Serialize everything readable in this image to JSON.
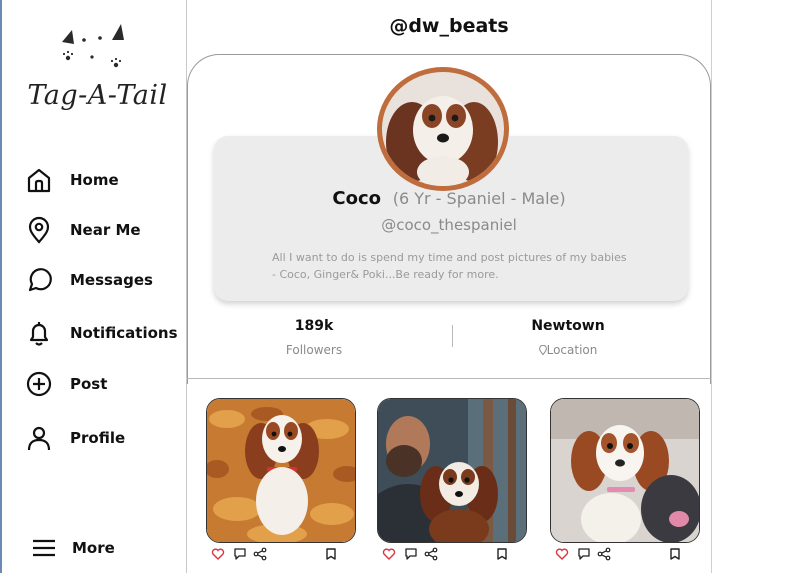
{
  "brand": {
    "logo_text": "Tag-A-Tail"
  },
  "nav": {
    "items": [
      {
        "label": "Home",
        "icon": "home-icon"
      },
      {
        "label": "Near Me",
        "icon": "location-pin-icon"
      },
      {
        "label": "Messages",
        "icon": "chat-bubble-icon"
      },
      {
        "label": "Notifications",
        "icon": "bell-icon"
      },
      {
        "label": "Post",
        "icon": "plus-circle-icon"
      },
      {
        "label": "Profile",
        "icon": "user-icon"
      }
    ],
    "more_label": "More"
  },
  "header": {
    "handle": "@dw_beats"
  },
  "profile": {
    "name": "Coco",
    "meta": "(6 Yr - Spaniel - Male)",
    "username": "@coco_thespaniel",
    "bio_line1": "All I want to do is spend my time and post pictures of my babies",
    "bio_line2": "- Coco, Ginger& Poki...Be ready for more.",
    "followers_value": "189k",
    "followers_label": "Followers",
    "location_value": "Newtown",
    "location_label": "Location"
  },
  "posts": [
    {
      "alt": "spaniel in autumn leaves"
    },
    {
      "alt": "man holding spaniel"
    },
    {
      "alt": "spaniel with plush toy"
    }
  ],
  "colors": {
    "accent": "#c06d3e",
    "heart": "#d9363e",
    "card_bg": "#ececec"
  }
}
